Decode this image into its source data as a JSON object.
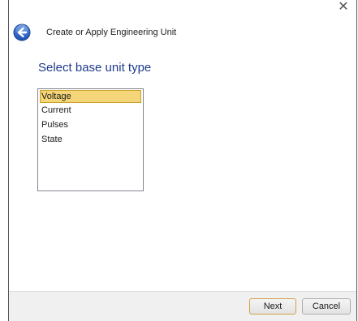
{
  "window": {
    "close_glyph": "✕",
    "close_icon": "close-icon",
    "back_icon": "back-arrow-icon",
    "accent_color": "#1f3a8c"
  },
  "header": {
    "title": "Create or Apply Engineering Unit"
  },
  "main": {
    "instruction": "Select base unit type",
    "unit_types": [
      {
        "label": "Voltage",
        "selected": true
      },
      {
        "label": "Current",
        "selected": false
      },
      {
        "label": "Pulses",
        "selected": false
      },
      {
        "label": "State",
        "selected": false
      }
    ],
    "selection_color": "#f5d57a"
  },
  "footer": {
    "next_label": "Next",
    "cancel_label": "Cancel"
  }
}
